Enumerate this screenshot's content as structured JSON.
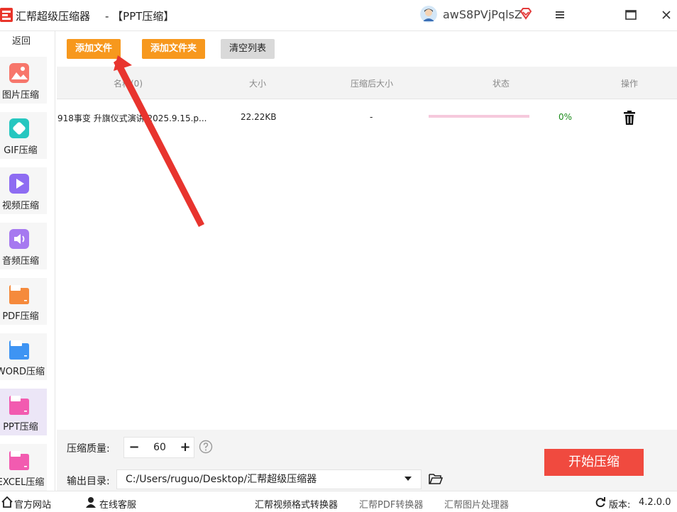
{
  "window": {
    "app_name": "汇帮超级压缩器",
    "page_title": "- 【PPT压缩】",
    "username": "awS8PVjPqlsZ"
  },
  "sidebar": {
    "back_label": "返回",
    "items": [
      {
        "label": "图片压缩",
        "icon": "image-compress-icon"
      },
      {
        "label": "GIF压缩",
        "icon": "gif-compress-icon"
      },
      {
        "label": "视频压缩",
        "icon": "video-compress-icon"
      },
      {
        "label": "音频压缩",
        "icon": "audio-compress-icon"
      },
      {
        "label": "PDF压缩",
        "icon": "pdf-compress-icon"
      },
      {
        "label": "WORD压缩",
        "icon": "word-compress-icon"
      },
      {
        "label": "PPT压缩",
        "icon": "ppt-compress-icon",
        "active": true
      },
      {
        "label": "EXCEL压缩",
        "icon": "excel-compress-icon"
      }
    ]
  },
  "toolbar": {
    "add_file": "添加文件",
    "add_folder": "添加文件夹",
    "clear_list": "清空列表"
  },
  "table": {
    "headers": {
      "name": "名称(0)",
      "size": "大小",
      "compressed_size": "压缩后大小",
      "status": "状态",
      "action": "操作"
    },
    "rows": [
      {
        "name": "918事变 升旗仪式演讲 2025.9.15.p...",
        "size": "22.22KB",
        "compressed_size": "-",
        "progress": 0,
        "percent": "0%"
      }
    ]
  },
  "settings": {
    "quality_label": "压缩质量:",
    "quality_value": "60",
    "minus": "−",
    "plus": "+",
    "output_label": "输出目录:",
    "output_path": "C:/Users/ruguo/Desktop/汇帮超级压缩器",
    "start_button": "开始压缩"
  },
  "footer": {
    "website": "官方网站",
    "support": "在线客服",
    "video_converter": "汇帮视频格式转换器",
    "pdf_converter": "汇帮PDF转换器",
    "image_processor": "汇帮图片处理器",
    "version_label": "版本:",
    "version": "4.2.0.0"
  },
  "colors": {
    "accent_orange": "#f7981d",
    "start_red": "#f04a3f",
    "progress_track": "#f6c9dc",
    "success_green": "#1a8a1a",
    "annotation_arrow": "#e8342e"
  }
}
